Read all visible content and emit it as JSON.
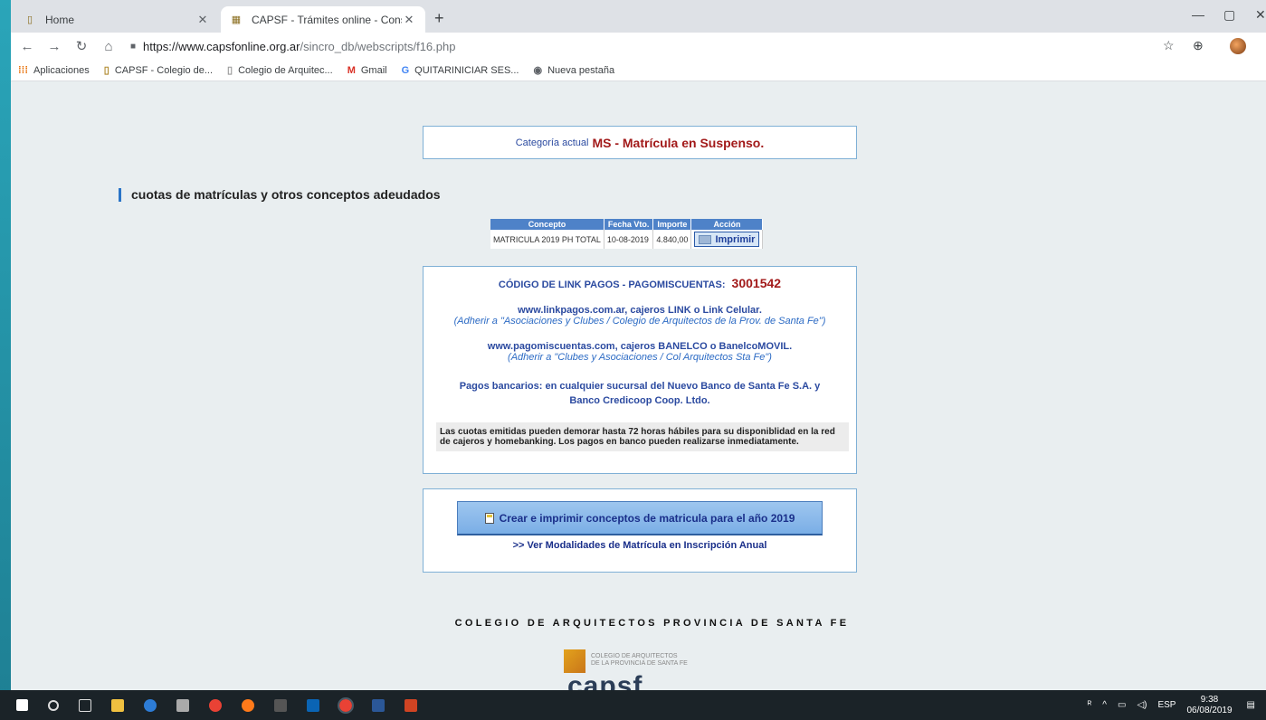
{
  "tabs": [
    {
      "title": "Home",
      "active": false
    },
    {
      "title": "CAPSF - Trámites online - Consul",
      "active": true
    }
  ],
  "browser": {
    "url_host": "https://www.capsfonline.org.ar",
    "url_path": "/sincro_db/webscripts/f16.php"
  },
  "bookmarks": [
    {
      "label": "Aplicaciones",
      "icon": "apps-grid-icon"
    },
    {
      "label": "CAPSF - Colegio de...",
      "icon": "capsf-icon"
    },
    {
      "label": "Colegio de Arquitec...",
      "icon": "capsf-icon"
    },
    {
      "label": "Gmail",
      "icon": "gmail-icon"
    },
    {
      "label": "QUITARINICIAR SES...",
      "icon": "google-icon"
    },
    {
      "label": "Nueva pestaña",
      "icon": "globe-icon"
    }
  ],
  "category": {
    "prefix": "Categoría actual",
    "value": "MS - Matrícula en Suspenso."
  },
  "section_title": "cuotas de matrículas y otros conceptos adeudados",
  "debt_table": {
    "headers": [
      "Concepto",
      "Fecha Vto.",
      "Importe",
      "Acción"
    ],
    "rows": [
      {
        "concepto": "MATRICULA 2019 PH TOTAL",
        "fecha": "10-08-2019",
        "importe": "4.840,00",
        "accion": "Imprimir"
      }
    ]
  },
  "payment": {
    "code_label": "CÓDIGO DE LINK PAGOS - PAGOMISCUENTAS:",
    "code_value": "3001542",
    "link_main": "www.linkpagos.com.ar, cajeros LINK o Link Celular.",
    "link_sub": "(Adherir a \"Asociaciones y Clubes / Colegio de Arquitectos de la Prov. de Santa Fe\")",
    "pmc_main": "www.pagomiscuentas.com, cajeros BANELCO o BanelcoMOVIL.",
    "pmc_sub": "(Adherir a \"Clubes y Asociaciones / Col Arquitectos Sta Fe\")",
    "bank_line1": "Pagos bancarios: en cualquier sucursal del Nuevo Banco de Santa Fe S.A. y",
    "bank_line2": "Banco Credicoop Coop. Ltdo.",
    "notice": "Las cuotas emitidas pueden demorar hasta 72 horas hábiles para su disponiblidad en la red de cajeros y homebanking. Los pagos en banco pueden realizarse inmediatamente."
  },
  "create": {
    "button_label": "Crear e imprimir conceptos de matricula para el año 2019",
    "link_label": ">> Ver Modalidades de Matrícula en Inscripción Anual"
  },
  "footer": {
    "title": "COLEGIO DE ARQUITECTOS PROVINCIA DE SANTA FE",
    "logo_small_1": "COLEGIO DE ARQUITECTOS",
    "logo_small_2": "DE LA PROVINCIA DE SANTA FE",
    "logo_big": "capsf"
  },
  "taskbar": {
    "language": "ESP",
    "time": "9:38",
    "date": "06/08/2019"
  },
  "colors": {
    "accent_red": "#a21a1a",
    "link_blue": "#2b4aa0",
    "table_header": "#4e82c8"
  }
}
